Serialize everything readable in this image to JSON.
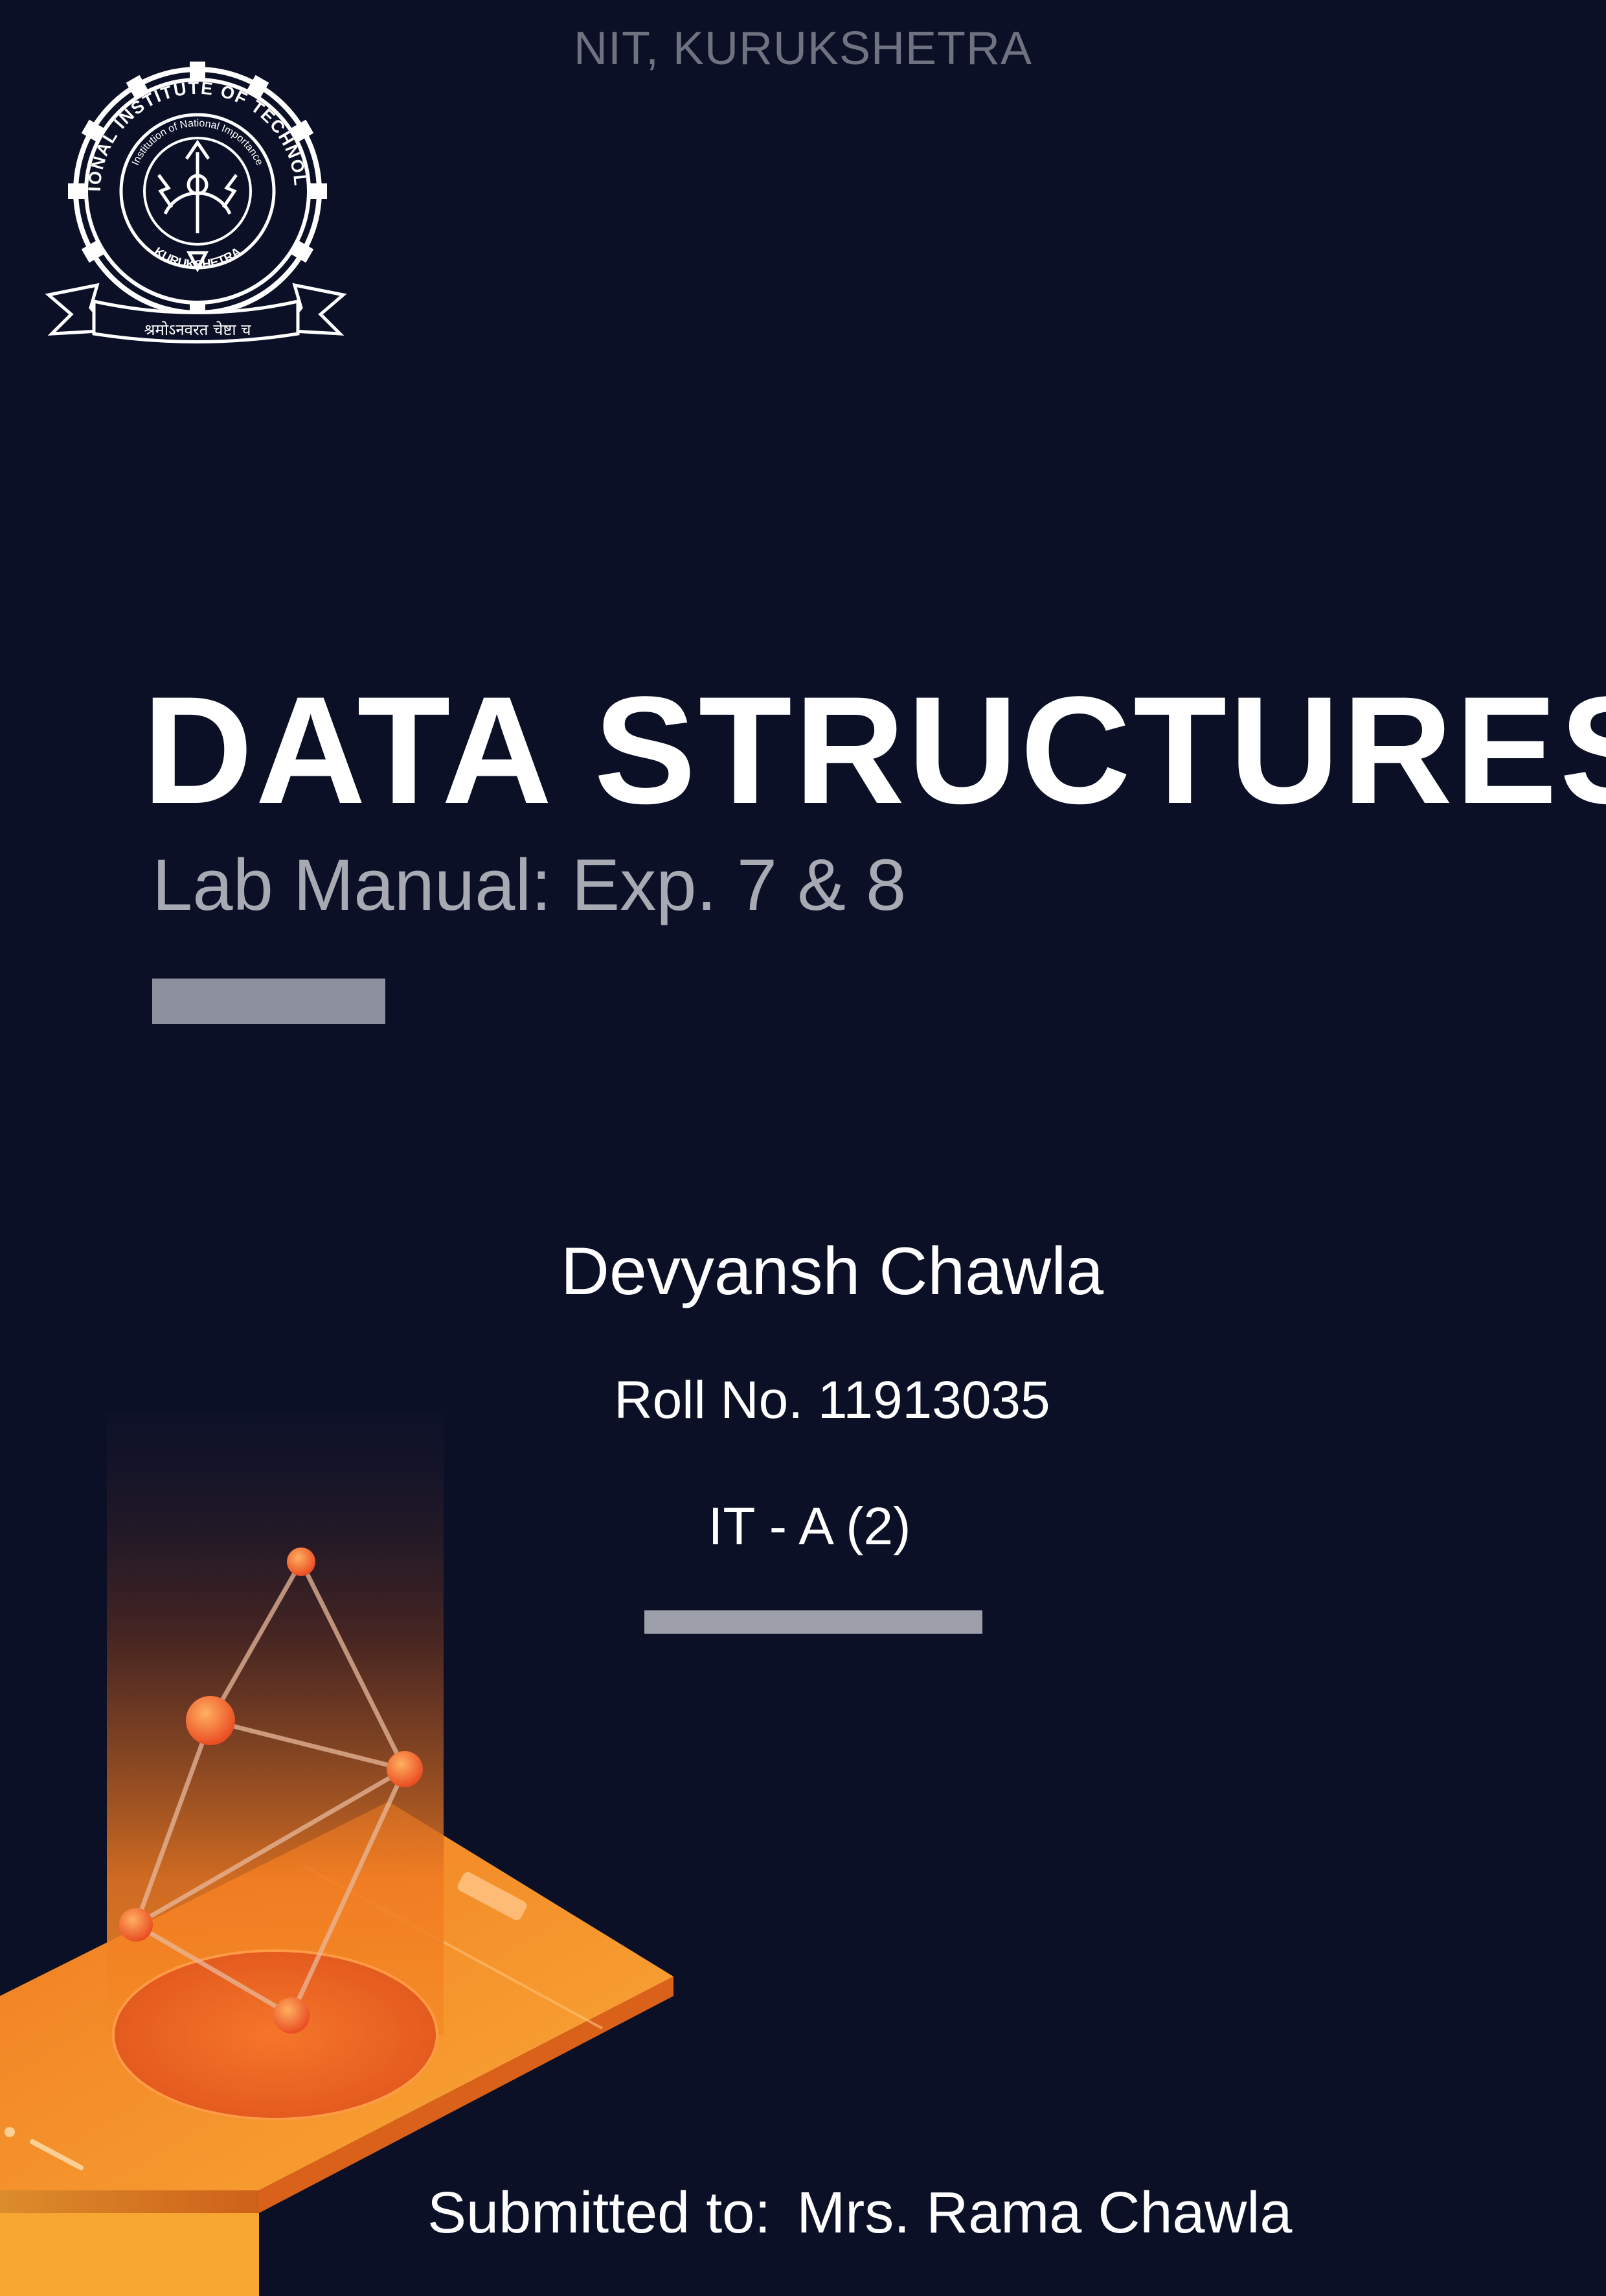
{
  "header": {
    "institute": "NIT, KURUKSHETRA"
  },
  "logo": {
    "ring_text": "NATIONAL INSTITUTE OF TECHNOLOGY",
    "inner_text": "Institution of National Importance",
    "city_text": "KURUKSHETRA",
    "motto": "श्रमोऽनवरत चेष्टा च"
  },
  "title": {
    "main": "DATA STRUCTURES",
    "subtitle": "Lab Manual: Exp. 7 & 8"
  },
  "student": {
    "name": "Devyansh Chawla",
    "roll": "Roll No. 11913035",
    "section": "IT - A (2)"
  },
  "footer": {
    "submitted_label": "Submitted to:",
    "submitted_to": "Mrs. Rama Chawla"
  },
  "colors": {
    "background": "#0b1026",
    "accent": "#f0782a",
    "muted_text": "#a7a9b3",
    "rule": "#8c8f9c"
  }
}
